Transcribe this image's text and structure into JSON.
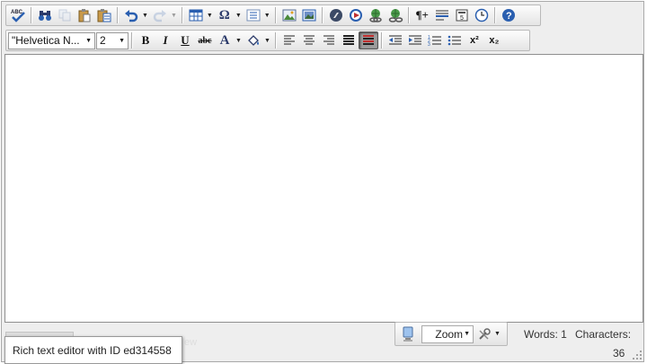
{
  "toolbar": {
    "font_name": "\"Helvetica N...",
    "font_size": "2",
    "underline_glyph": "U",
    "strike_glyph": "abc",
    "font_color_glyph": "A",
    "superscript_glyph": "x²",
    "subscript_glyph": "x₂",
    "special_char_glyph": "Ω",
    "paragraph_glyph": "¶+"
  },
  "statusbar": {
    "zoom_label": "Zoom",
    "words": "Words: 1",
    "characters_label": "Characters:",
    "characters_value": "36"
  },
  "tooltip": {
    "text": "Rich text editor with ID ed314558"
  },
  "hidden_tab_fragment": "ew",
  "colors": {
    "active_button": "#9c9c9c",
    "toolbar_bg": "#e4e4e4",
    "icon_blue": "#2a5fb0"
  }
}
